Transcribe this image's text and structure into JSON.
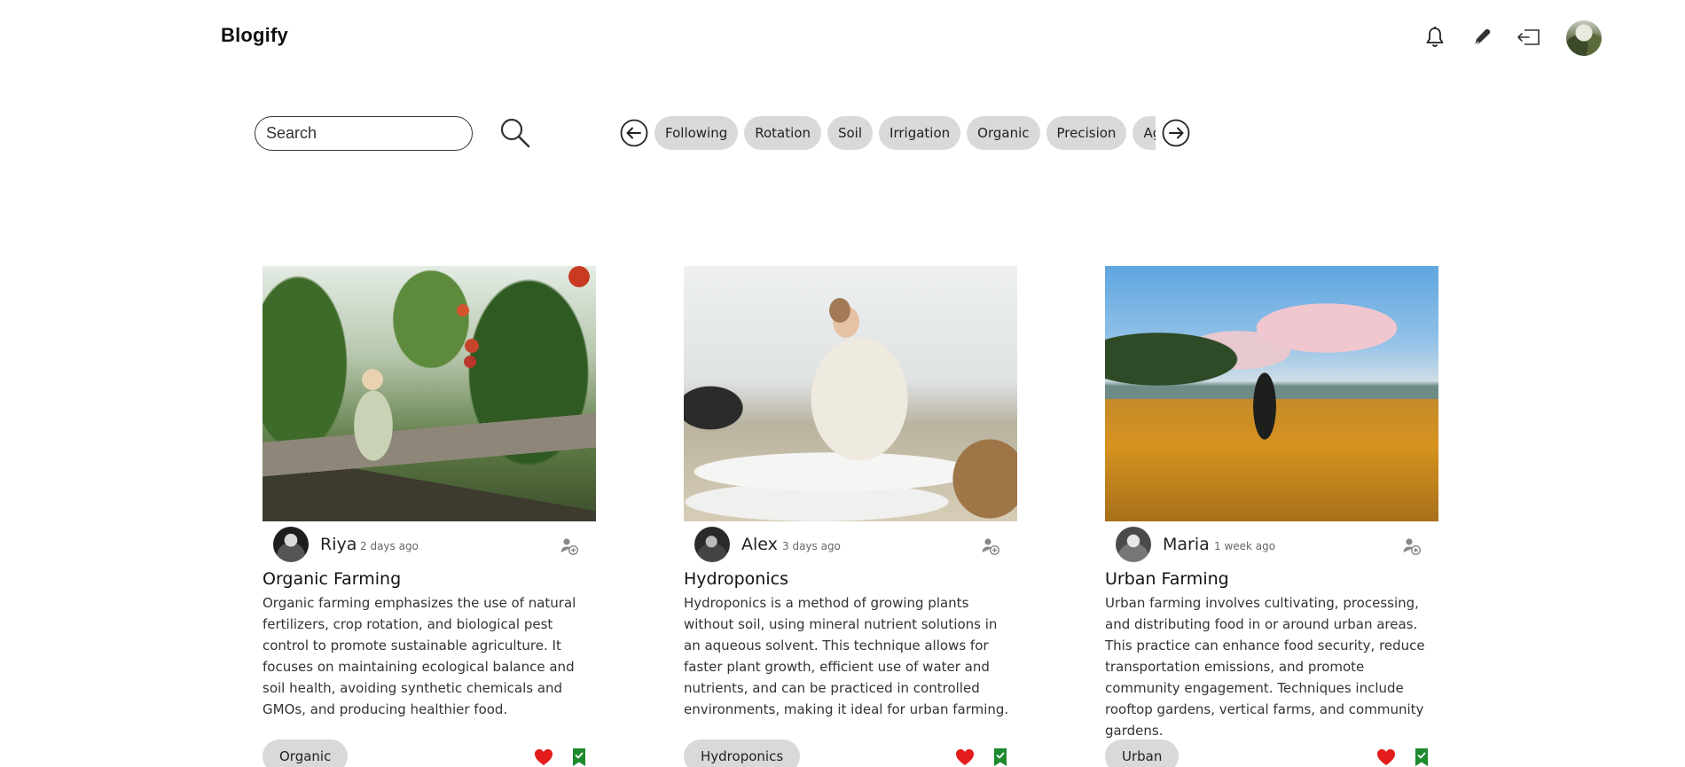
{
  "app": {
    "title": "Blogify"
  },
  "header": {
    "icons": [
      "bell-icon",
      "pen-icon",
      "logout-icon"
    ],
    "avatar": "profile-avatar"
  },
  "search": {
    "placeholder": "Search",
    "value": ""
  },
  "categories": [
    "Following",
    "Rotation",
    "Soil",
    "Irrigation",
    "Organic",
    "Precision",
    "Agro"
  ],
  "posts": [
    {
      "author": "Riya",
      "time": "2 days ago",
      "title": "Organic Farming",
      "description": "Organic farming emphasizes the use of natural fertilizers, crop rotation, and biological pest control to promote sustainable agriculture. It focuses on maintaining ecological balance and soil health, avoiding synthetic chemicals and GMOs, and producing healthier food.",
      "tag": "Organic"
    },
    {
      "author": "Alex",
      "time": "3 days ago",
      "title": "Hydroponics",
      "description": "Hydroponics is a method of growing plants without soil, using mineral nutrient solutions in an aqueous solvent. This technique allows for faster plant growth, efficient use of water and nutrients, and can be practiced in controlled environments, making it ideal for urban farming.",
      "tag": "Hydroponics"
    },
    {
      "author": "Maria",
      "time": "1 week ago",
      "title": "Urban Farming",
      "description": "Urban farming involves cultivating, processing, and distributing food in or around urban areas. This practice can enhance food security, reduce transportation emissions, and promote community engagement. Techniques include rooftop gardens, vertical farms, and community gardens.",
      "tag": "Urban"
    }
  ],
  "colors": {
    "like": "#e31b1b",
    "save": "#1e8a2e",
    "chip_bg": "#d9d9d9"
  }
}
